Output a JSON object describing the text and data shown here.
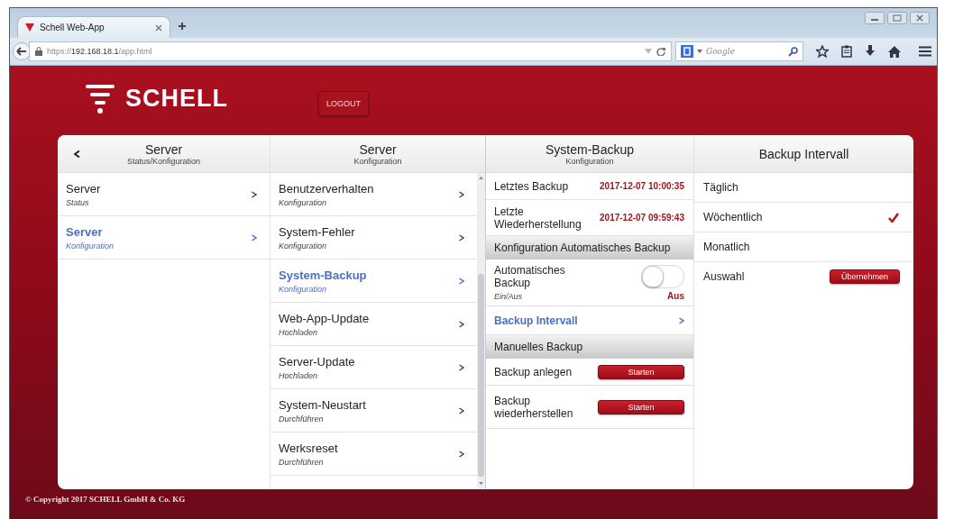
{
  "browser": {
    "tab": {
      "title": "Schell Web-App"
    },
    "url": {
      "scheme": "https://",
      "host": "192.168.18.1",
      "path": "/app.html"
    },
    "search": {
      "placeholder": "Google"
    }
  },
  "app": {
    "logo": "SCHELL",
    "logout": "LOGOUT",
    "columns": [
      {
        "title": "Server",
        "subtitle": "Status/Konfiguration",
        "back": true,
        "items": [
          {
            "title": "Server",
            "subtitle": "Status",
            "selected": false
          },
          {
            "title": "Server",
            "subtitle": "Konfiguration",
            "selected": true
          }
        ]
      },
      {
        "title": "Server",
        "subtitle": "Konfiguration",
        "back": false,
        "items": [
          {
            "title": "Benutzerverhalten",
            "subtitle": "Konfiguration",
            "selected": false
          },
          {
            "title": "System-Fehler",
            "subtitle": "Konfiguration",
            "selected": false
          },
          {
            "title": "System-Backup",
            "subtitle": "Konfiguration",
            "selected": true
          },
          {
            "title": "Web-App-Update",
            "subtitle": "Hochladen",
            "selected": false
          },
          {
            "title": "Server-Update",
            "subtitle": "Hochladen",
            "selected": false
          },
          {
            "title": "System-Neustart",
            "subtitle": "Durchführen",
            "selected": false
          },
          {
            "title": "Werksreset",
            "subtitle": "Durchführen",
            "selected": false
          }
        ]
      }
    ],
    "detail": {
      "title": "System-Backup",
      "subtitle": "Konfiguration",
      "rows": [
        {
          "kind": "info",
          "label": "Letztes Backup",
          "value": "2017-12-07 10:00:35"
        },
        {
          "kind": "info",
          "label": "Letzte Wiederherstellung",
          "value": "2017-12-07 09:59:43"
        },
        {
          "kind": "section",
          "label": "Konfiguration Automatisches Backup"
        },
        {
          "kind": "toggle",
          "label": "Automatisches Backup",
          "hint": "Ein/Aus",
          "on": false,
          "state": "Aus"
        },
        {
          "kind": "link",
          "label": "Backup Intervall",
          "selected": true
        },
        {
          "kind": "section",
          "label": "Manuelles Backup"
        },
        {
          "kind": "action",
          "label": "Backup anlegen",
          "button": "Starten"
        },
        {
          "kind": "action",
          "label": "Backup wiederherstellen",
          "button": "Starten"
        }
      ]
    },
    "interval": {
      "title": "Backup Intervall",
      "options": [
        {
          "label": "Täglich",
          "selected": false
        },
        {
          "label": "Wöchentlich",
          "selected": true
        },
        {
          "label": "Monatlich",
          "selected": false
        }
      ],
      "apply": {
        "label": "Auswahl",
        "button": "Übernehmen"
      }
    },
    "footer": "© Copyright 2017 SCHELL GmbH & Co. KG"
  }
}
